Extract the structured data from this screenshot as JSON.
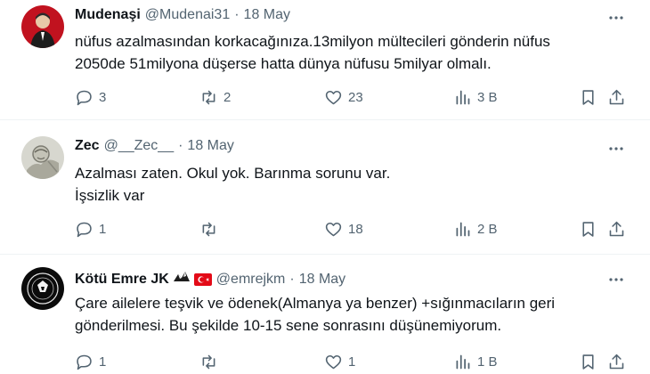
{
  "tweets": [
    {
      "name": "Mudenaşi",
      "handle": "@Mudenai31",
      "date": "18 May",
      "text_lines": [
        "nüfus azalmasından korkacağınıza.13milyon mültecileri gönderin nüfus",
        "2050de 51milyona düşerse hatta dünya nüfusu 5milyar olmalı."
      ],
      "replies": "3",
      "reposts": "2",
      "likes": "23",
      "views": "3 B"
    },
    {
      "name": "Zec",
      "handle": "@__Zec__",
      "date": "18 May",
      "text_lines": [
        "Azalması zaten. Okul yok. Barınma sorunu var.",
        "İşsizlik var"
      ],
      "replies": "1",
      "reposts": "",
      "likes": "18",
      "views": "2 B"
    },
    {
      "name": "Kötü Emre JK",
      "handle": "@emrejkm",
      "date": "18 May",
      "text_lines": [
        "Çare ailelere teşvik ve ödenek(Almanya ya benzer) +sığınmacıların geri",
        "gönderilmesi. Bu şekilde 10-15 sene sonrasını düşünemiyorum."
      ],
      "replies": "1",
      "reposts": "",
      "likes": "1",
      "views": "1 B"
    }
  ],
  "separator": "·",
  "colors": {
    "text": "#0f1419",
    "secondary": "#536471",
    "divider": "#eff3f4",
    "flag": "#e30a17"
  },
  "icons": [
    "reply-icon",
    "repost-icon",
    "like-icon",
    "views-icon",
    "bookmark-icon",
    "share-icon",
    "more-icon"
  ]
}
